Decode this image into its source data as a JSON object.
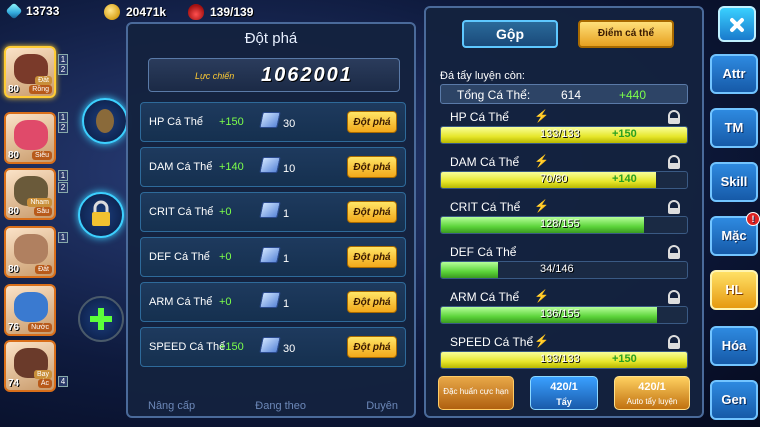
{
  "resources": {
    "diamonds": "13733",
    "gold": "20471k",
    "potion": "139/139"
  },
  "party": [
    {
      "level": "80",
      "type1": "Rồng",
      "type2": "Đất",
      "color": "#7a3a2a"
    },
    {
      "level": "80",
      "type1": "Siêu",
      "type2": "",
      "color": "#e04a6a"
    },
    {
      "level": "80",
      "type1": "Sâu",
      "type2": "Nham",
      "color": "#6a5a3a"
    },
    {
      "level": "80",
      "type1": "Đất",
      "type2": "",
      "color": "#b08060"
    },
    {
      "level": "76",
      "type1": "Nước",
      "type2": "",
      "color": "#3a7ad0"
    },
    {
      "level": "74",
      "type1": "Ác",
      "type2": "Bay",
      "color": "#6a3a2a"
    }
  ],
  "party_side_badges": [
    "1",
    "2",
    "1",
    "2",
    "1",
    "2",
    "1",
    "4"
  ],
  "breakthrough": {
    "title": "Đột phá",
    "power_label": "Lực chiến",
    "power_value": "1062001",
    "rows": [
      {
        "label": "HP Cá Thể",
        "add": "+150",
        "cost": "30",
        "button": "Đột phá"
      },
      {
        "label": "DAM Cá Thể",
        "add": "+140",
        "cost": "10",
        "button": "Đột phá"
      },
      {
        "label": "CRIT Cá Thể",
        "add": "+0",
        "cost": "1",
        "button": "Đột phá"
      },
      {
        "label": "DEF Cá Thể",
        "add": "+0",
        "cost": "1",
        "button": "Đột phá"
      },
      {
        "label": "ARM Cá Thể",
        "add": "+0",
        "cost": "1",
        "button": "Đột phá"
      },
      {
        "label": "SPEED Cá Thể",
        "add": "+150",
        "cost": "30",
        "button": "Đột phá"
      }
    ],
    "bottom_labels": [
      "Nâng cấp",
      "Đang theo",
      "Duyên"
    ]
  },
  "training": {
    "tab_merge": "Gộp",
    "tab_points": "Điểm cá thể",
    "remaining_label": "Đá tẩy luyện còn:",
    "total_label": "Tổng Cá Thể:",
    "total_value": "614",
    "total_add": "+440",
    "stats": [
      {
        "name": "HP Cá Thể",
        "value": "133/133",
        "fill": 1.0,
        "add": "+150",
        "color": "yellow",
        "spark": true
      },
      {
        "name": "DAM Cá Thể",
        "value": "70/80",
        "fill": 0.875,
        "add": "+140",
        "color": "yellow",
        "spark": true
      },
      {
        "name": "CRIT Cá Thể",
        "value": "128/155",
        "fill": 0.826,
        "add": "",
        "color": "green",
        "spark": true
      },
      {
        "name": "DEF Cá Thể",
        "value": "34/146",
        "fill": 0.233,
        "add": "",
        "color": "green",
        "spark": false
      },
      {
        "name": "ARM Cá Thể",
        "value": "136/155",
        "fill": 0.877,
        "add": "",
        "color": "green",
        "spark": true
      },
      {
        "name": "SPEED Cá Thể",
        "value": "133/133",
        "fill": 1.0,
        "add": "+150",
        "color": "yellow",
        "spark": true
      }
    ],
    "btn_special": "Đặc huấn cực hạn",
    "btn_wash_count": "420/1",
    "btn_wash_label": "Tẩy",
    "btn_auto_count": "420/1",
    "btn_auto_label": "Auto tẩy luyện"
  },
  "side_nav": [
    {
      "label": "Attr",
      "active": false,
      "alert": false
    },
    {
      "label": "TM",
      "active": false,
      "alert": false
    },
    {
      "label": "Skill",
      "active": false,
      "alert": false
    },
    {
      "label": "Mặc",
      "active": false,
      "alert": true
    },
    {
      "label": "HL",
      "active": true,
      "alert": false
    },
    {
      "label": "Hóa",
      "active": false,
      "alert": false
    },
    {
      "label": "Gen",
      "active": false,
      "alert": false
    }
  ],
  "colors": {
    "accent_green": "#7cff4a",
    "button_gold": "#f2a81a",
    "panel": "#14223e",
    "border": "#4a6a9a"
  }
}
